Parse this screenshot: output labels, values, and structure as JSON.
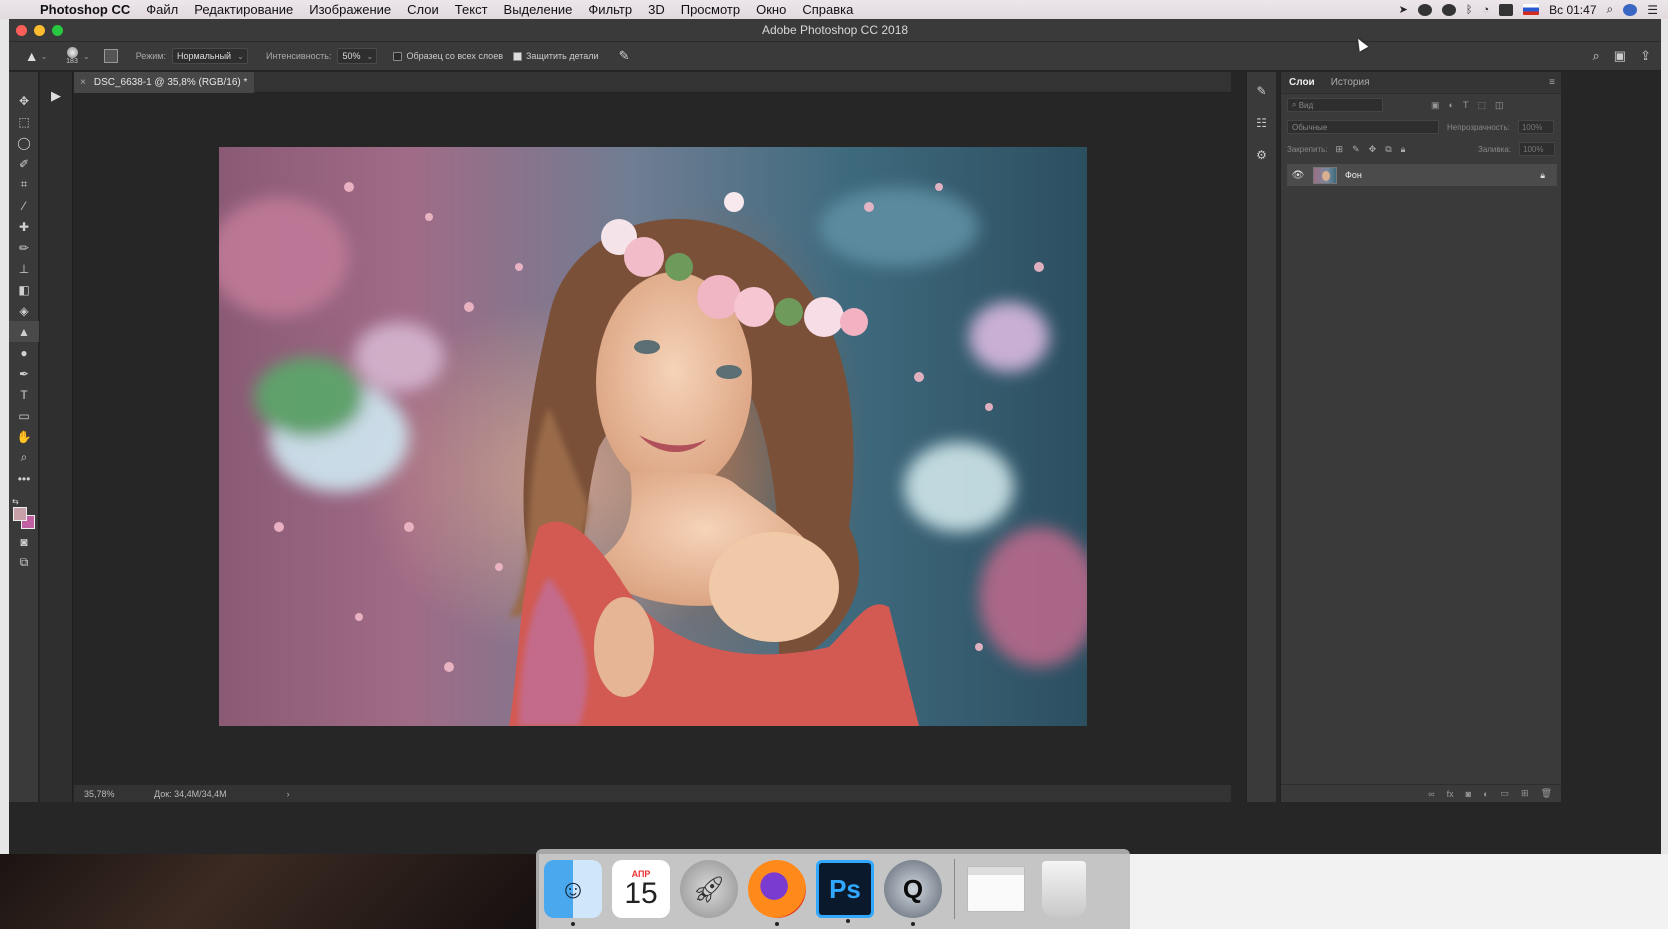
{
  "menubar": {
    "app_name": "Photoshop CC",
    "items": [
      "Файл",
      "Редактирование",
      "Изображение",
      "Слои",
      "Текст",
      "Выделение",
      "Фильтр",
      "3D",
      "Просмотр",
      "Окно",
      "Справка"
    ],
    "clock": "Вс 01:47"
  },
  "window": {
    "title": "Adobe Photoshop CC 2018"
  },
  "options": {
    "brush_size": "183",
    "mode_label": "Режим:",
    "mode_value": "Нормальный",
    "intensity_label": "Интенсивность:",
    "intensity_value": "50%",
    "sample_all_layers": "Образец со всех слоев",
    "protect_detail": "Защитить детали"
  },
  "document": {
    "tab_label": "DSC_6638-1 @ 35,8% (RGB/16) *",
    "zoom": "35,78%",
    "doc_info": "Док: 34,4M/34,4M"
  },
  "layers_panel": {
    "tabs": [
      "Слои",
      "История"
    ],
    "kind_placeholder": "Вид",
    "blend_mode": "Обычные",
    "opacity_label": "Непрозрачность:",
    "opacity_value": "100%",
    "lock_label": "Закрепить:",
    "fill_label": "Заливка:",
    "fill_value": "100%",
    "layers": [
      {
        "name": "Фон"
      }
    ]
  },
  "dock": {
    "calendar_month": "АПР",
    "calendar_day": "15",
    "ps_label": "Ps"
  },
  "colors": {
    "foreground": "#c8a0a8",
    "background": "#c060a0",
    "ps_accent": "#31a8ff"
  }
}
